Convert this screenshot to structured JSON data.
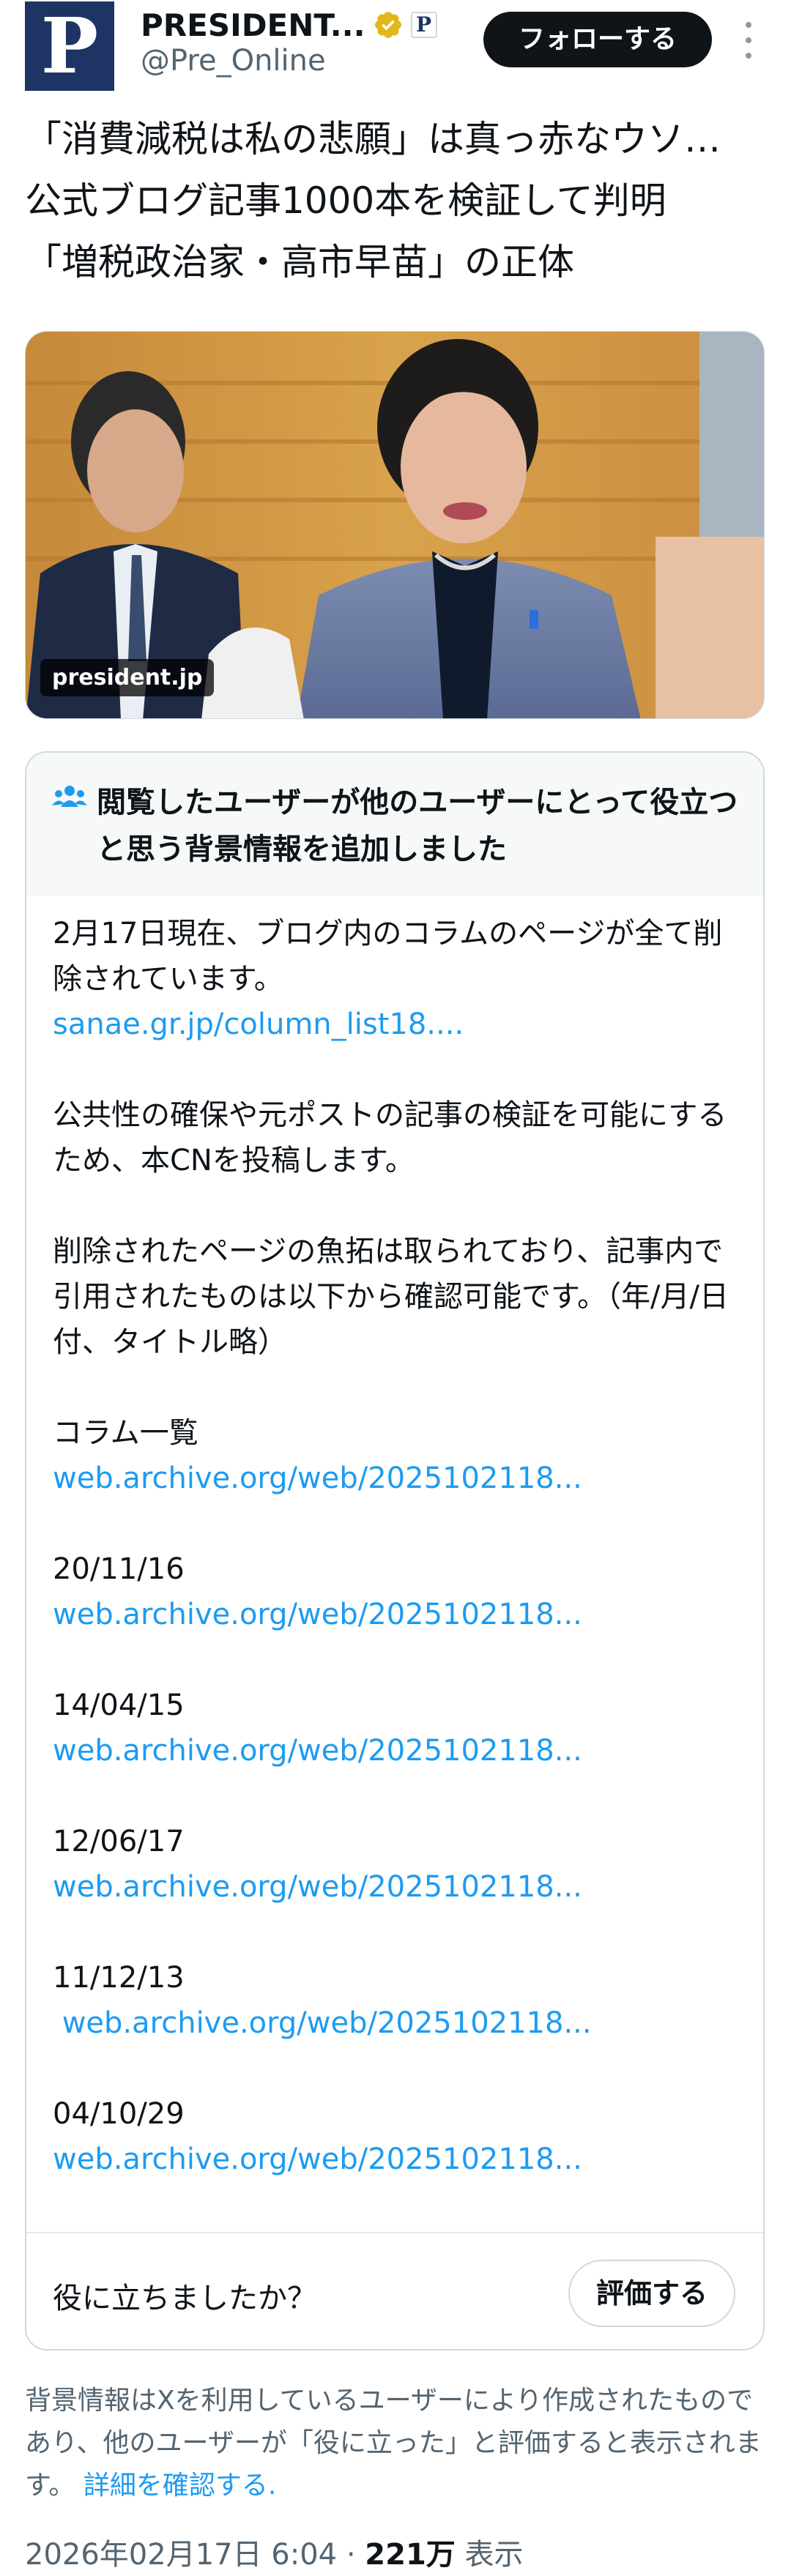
{
  "author": {
    "display_name": "PRESIDENT...",
    "handle": "@Pre_Online",
    "logo_letter": "P",
    "affiliate_letter": "P",
    "verified_badge_color": "#e2b719"
  },
  "follow_button": {
    "label": "フォローする"
  },
  "post": {
    "lines": [
      "「消費減税は私の悲願」は真っ赤なウソ…",
      "公式ブログ記事1000本を検証して判明",
      "「増税政治家・高市早苗」の正体"
    ]
  },
  "media": {
    "domain": "president.jp"
  },
  "community_note": {
    "header_title": "閲覧したユーザーが他のユーザーにとって役立つと思う背景情報を追加しました",
    "paragraph1": "2月17日現在、ブログ内のコラムのページが全て削除されています。",
    "link1": "sanae.gr.jp/column_list18....",
    "paragraph2": "公共性の確保や元ポストの記事の検証を可能にするため、本CNを投稿します。",
    "paragraph3": "削除されたページの魚拓は取られており、記事内で引用されたものは以下から確認可能です。（年/月/日付、タイトル略）",
    "entries": [
      {
        "label": "コラム一覧",
        "link": "web.archive.org/web/2025102118..."
      },
      {
        "label": "20/11/16",
        "link": "web.archive.org/web/2025102118..."
      },
      {
        "label": "14/04/15",
        "link": "web.archive.org/web/2025102118..."
      },
      {
        "label": "12/06/17",
        "link": "web.archive.org/web/2025102118..."
      },
      {
        "label": "11/12/13",
        "link": " web.archive.org/web/2025102118..."
      },
      {
        "label": "04/10/29",
        "link": "web.archive.org/web/2025102118..."
      }
    ],
    "helpful_question": "役に立ちましたか？",
    "rate_button": "評価する"
  },
  "disclaimer": {
    "text": "背景情報はXを利用しているユーザーにより作成されたものであり、他のユーザーが「役に立った」と評価すると表示されます。",
    "learn_more": "詳細を確認する."
  },
  "meta": {
    "timestamp": "2026年02月17日 6:04",
    "separator": "·",
    "views_count": "221万",
    "views_label": "表示"
  },
  "colors": {
    "link": "#1d9bf0",
    "brand_navy": "#1d3464",
    "follow_button_bg": "#0f1419"
  }
}
